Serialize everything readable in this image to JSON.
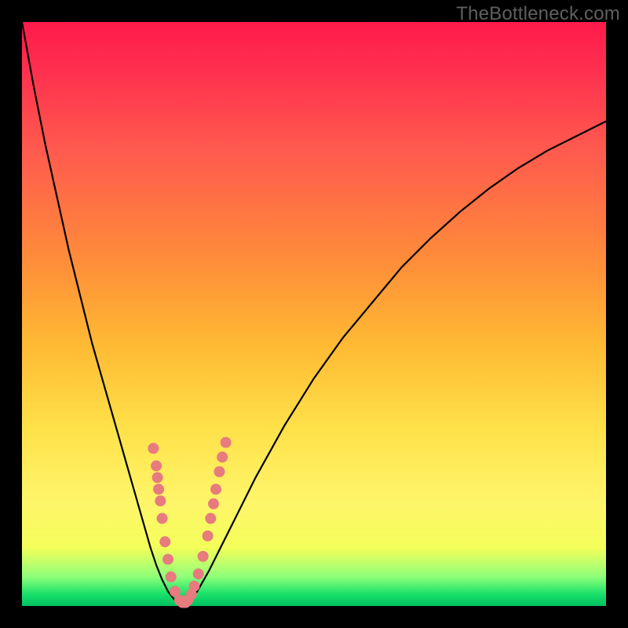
{
  "watermark": "TheBottleneck.com",
  "colors": {
    "frame": "#000000",
    "curve_stroke": "#000000",
    "marker_fill": "#e77b7d",
    "gradient_top": "#ff1a4b",
    "gradient_bottom": "#00c060"
  },
  "chart_data": {
    "type": "line",
    "title": "",
    "xlabel": "",
    "ylabel": "",
    "xlim": [
      0,
      100
    ],
    "ylim": [
      0,
      100
    ],
    "x": [
      0,
      2,
      4,
      6,
      8,
      10,
      12,
      14,
      16,
      18,
      20,
      22,
      23,
      24,
      25,
      26,
      27,
      28,
      29,
      30,
      32,
      34,
      36,
      40,
      45,
      50,
      55,
      60,
      65,
      70,
      75,
      80,
      85,
      90,
      95,
      100
    ],
    "y": [
      100,
      89,
      79,
      70,
      61,
      53,
      45,
      38,
      31,
      24,
      17,
      10,
      7,
      4.5,
      2.5,
      1.2,
      0.5,
      0.5,
      1.2,
      2.5,
      6,
      10,
      14,
      22,
      31,
      39,
      46,
      52,
      58,
      63,
      67.5,
      71.5,
      75,
      78,
      80.5,
      83
    ],
    "markers": [
      {
        "x": 22.5,
        "y": 27
      },
      {
        "x": 23.0,
        "y": 24
      },
      {
        "x": 23.2,
        "y": 22
      },
      {
        "x": 23.4,
        "y": 20
      },
      {
        "x": 23.7,
        "y": 18
      },
      {
        "x": 24.0,
        "y": 15
      },
      {
        "x": 24.5,
        "y": 11
      },
      {
        "x": 25.0,
        "y": 8
      },
      {
        "x": 25.5,
        "y": 5
      },
      {
        "x": 26.2,
        "y": 2.5
      },
      {
        "x": 27.0,
        "y": 1.0
      },
      {
        "x": 27.5,
        "y": 0.6
      },
      {
        "x": 28.0,
        "y": 0.6
      },
      {
        "x": 28.4,
        "y": 1.0
      },
      {
        "x": 29.0,
        "y": 2.0
      },
      {
        "x": 29.5,
        "y": 3.4
      },
      {
        "x": 30.2,
        "y": 5.5
      },
      {
        "x": 31.0,
        "y": 8.5
      },
      {
        "x": 31.8,
        "y": 12
      },
      {
        "x": 32.3,
        "y": 15
      },
      {
        "x": 32.8,
        "y": 17.5
      },
      {
        "x": 33.2,
        "y": 20
      },
      {
        "x": 33.8,
        "y": 23
      },
      {
        "x": 34.3,
        "y": 25.5
      },
      {
        "x": 34.9,
        "y": 28
      }
    ]
  }
}
